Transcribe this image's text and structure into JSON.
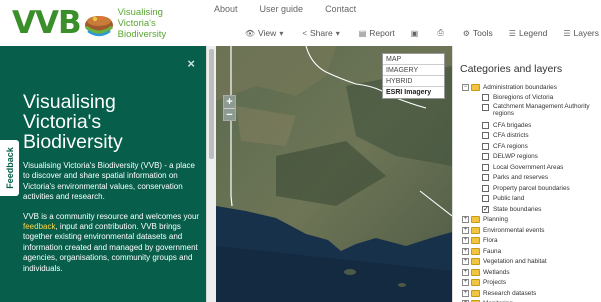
{
  "brand": {
    "logo_text": "VVB",
    "subtitle_line1": "Visualising",
    "subtitle_line2": "Victoria's",
    "subtitle_line3": "Biodiversity",
    "color": "#3a8f2b"
  },
  "topnav": [
    "About",
    "User guide",
    "Contact"
  ],
  "toolbar": {
    "view": "View",
    "share": "Share",
    "report": "Report",
    "tools": "Tools",
    "legend": "Legend",
    "layers": "Layers"
  },
  "left_panel": {
    "feedback": "Feedback",
    "close": "×",
    "title": "Visualising Victoria's Biodiversity",
    "para1": "Visualising Victoria's Biodiversity (VVB) - a place to discover and share spatial information on Victoria's environmental values, conservation activities and research.",
    "para2_before": "VVB is a community resource and welcomes your ",
    "para2_link": "feedback",
    "para2_after": ", input and contribution. VVB brings together existing environmental datasets and information created and managed by government agencies, organisations, community groups and individuals.",
    "bg_color": "#065e4b"
  },
  "map": {
    "zoom_in": "+",
    "zoom_out": "−",
    "basemaps": [
      "MAP",
      "IMAGERY",
      "HYBRID",
      "ESRI Imagery"
    ],
    "selected_basemap": "ESRI Imagery"
  },
  "right_panel": {
    "title": "Categories and layers",
    "group": "Administration boundaries",
    "layers": [
      {
        "label": "Bioregions of Victoria",
        "checked": false
      },
      {
        "label": "Catchment Management Authority regions",
        "checked": false
      },
      {
        "label": "CFA brigades",
        "checked": false
      },
      {
        "label": "CFA districts",
        "checked": false
      },
      {
        "label": "CFA regions",
        "checked": false
      },
      {
        "label": "DELWP regions",
        "checked": false
      },
      {
        "label": "Local Government Areas",
        "checked": false
      },
      {
        "label": "Parks and reserves",
        "checked": false
      },
      {
        "label": "Property parcel boundaries",
        "checked": false
      },
      {
        "label": "Public land",
        "checked": false
      },
      {
        "label": "State boundaries",
        "checked": true
      }
    ],
    "categories": [
      "Planning",
      "Environmental events",
      "Flora",
      "Fauna",
      "Vegetation and habitat",
      "Wetlands",
      "Projects",
      "Research datasets",
      "Monitoring"
    ]
  }
}
